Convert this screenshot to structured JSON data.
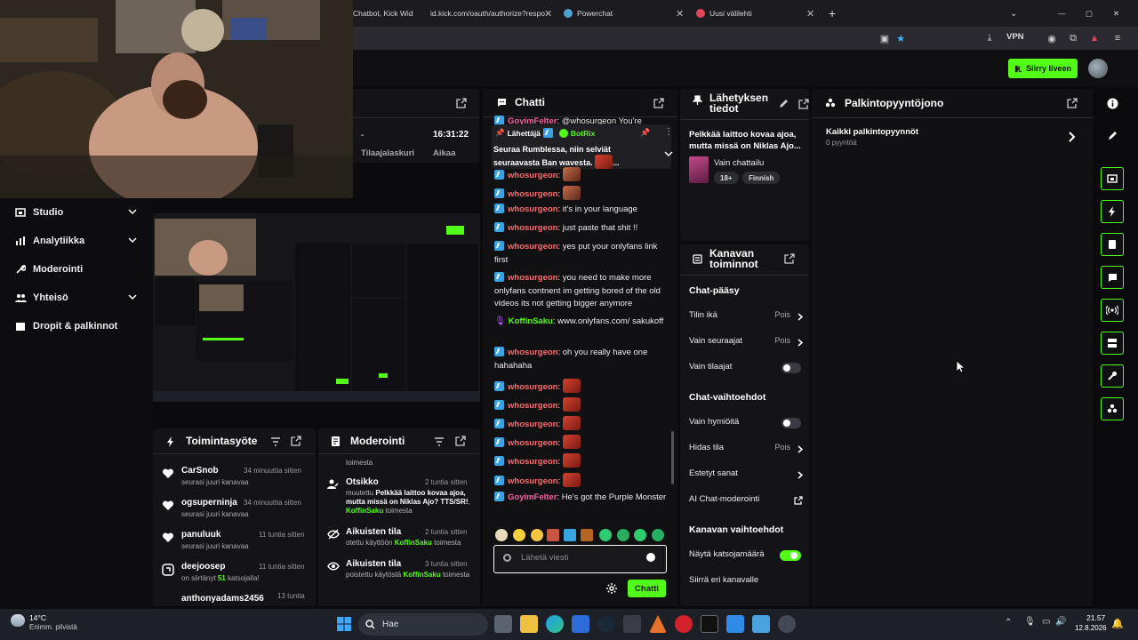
{
  "browser": {
    "tabs": [
      {
        "title": "Chatbot, Kick Wid"
      },
      {
        "title": "id.kick.com/oauth/authorize?respo"
      },
      {
        "title": "Powerchat"
      },
      {
        "title": "Uusi välilehti"
      }
    ],
    "vpn_label": "VPN",
    "new_tab": "+",
    "window_controls": [
      "—",
      "▢",
      "✕"
    ]
  },
  "header": {
    "go_live_label": "Siirry liveen"
  },
  "sidebar": {
    "items": [
      {
        "label": "Studio",
        "icon": "studio-icon",
        "expandable": true
      },
      {
        "label": "Analytiikka",
        "icon": "analytics-icon",
        "expandable": true
      },
      {
        "label": "Moderointi",
        "icon": "wrench-icon",
        "expandable": false
      },
      {
        "label": "Yhteisö",
        "icon": "community-icon",
        "expandable": true
      },
      {
        "label": "Dropit & palkinnot",
        "icon": "drops-icon",
        "expandable": false
      }
    ]
  },
  "stats": {
    "left_value": "-",
    "left_label": "Tilaajalaskuri",
    "right_value": "16:31:22",
    "right_label": "Aikaa"
  },
  "activity": {
    "title": "Toimintasyöte",
    "items": [
      {
        "name": "CarSnob",
        "desc": "seurasi juuri kanavaa",
        "time": "34 minuuttia sitten",
        "icon": "heart-icon"
      },
      {
        "name": "ogsuperninja",
        "desc": "seurasi juuri kanavaa",
        "time": "34 minuuttia sitten",
        "icon": "heart-icon"
      },
      {
        "name": "panuluuk",
        "desc": "seurasi juuri kanavaa",
        "time": "11 tuntia sitten",
        "icon": "heart-icon"
      },
      {
        "name": "deejoosep",
        "desc_prefix": "on siirtänyt ",
        "desc_count": "51",
        "desc_suffix": " katsojalla!",
        "time": "11 tuntia sitten",
        "icon": "host-icon"
      },
      {
        "name": "anthonyadams2456",
        "time": "13 tuntia"
      }
    ]
  },
  "moderation": {
    "title": "Moderointi",
    "top_text": "toimesta",
    "items": [
      {
        "title": "Otsikko",
        "time": "2 tuntia sitten",
        "d1": "muutettu ",
        "d_bold": "Pelkkää laittoo kovaa ajoa, mutta missä on Niklas Ajo? TTS/SR!",
        "d2": ", ",
        "user": "KoffinSaku",
        "d3": " toimesta"
      },
      {
        "title": "Aikuisten tila",
        "time": "2 tuntia sitten",
        "d1": "otettu käyttöön ",
        "user": "KoffinSaku",
        "d3": " toimesta"
      },
      {
        "title": "Aikuisten tila",
        "time": "3 tuntia sitten",
        "d1": "poistettu käytöstä ",
        "user": "KoffinSaku",
        "d3": " toimesta"
      }
    ]
  },
  "chat": {
    "title": "Chatti",
    "top_cut": {
      "user": "GoyimFelter",
      "text": "@whosurgeon You're"
    },
    "pinned": {
      "label": "Lähettäjä",
      "sender": "BotRix",
      "text": "Seuraa Rumblessa, niin selviät seuraavasta Ban wavesta.",
      "ellipsis": "..."
    },
    "messages": [
      {
        "user": "whosurgeon",
        "text": "",
        "emotes": 1
      },
      {
        "user": "whosurgeon",
        "text": "",
        "emotes": 1
      },
      {
        "user": "whosurgeon",
        "text": "it's in your language"
      },
      {
        "user": "whosurgeon",
        "text": "just paste that shit !!"
      },
      {
        "user": "whosurgeon",
        "text": "yes put your onlyfans link first"
      },
      {
        "user": "whosurgeon",
        "text": "you need to make more onlyfans contnent im getting bored of the old videos its not getting bigger anymore"
      },
      {
        "user": "KoffinSaku",
        "text": "www.onlyfans.com/ sakukoff",
        "mod": true
      },
      {
        "user": "whosurgeon",
        "text": "oh you really have one hahahaha"
      },
      {
        "user": "whosurgeon",
        "text": "",
        "emotes": 1
      },
      {
        "user": "whosurgeon",
        "text": "",
        "emotes": 1
      },
      {
        "user": "whosurgeon",
        "text": "",
        "emotes": 1
      },
      {
        "user": "whosurgeon",
        "text": "",
        "emotes": 1
      },
      {
        "user": "whosurgeon",
        "text": "",
        "emotes": 1
      },
      {
        "user": "whosurgeon",
        "text": "",
        "emotes": 1
      },
      {
        "user": "GoyimFelter",
        "text": "He's got the Purple Monster"
      }
    ],
    "input_placeholder": "Lähetä viesti",
    "send_label": "Chatti"
  },
  "stream_info": {
    "title": "Lähetyksen tiedot",
    "stream_title": "Pelkkää laittoo kovaa ajoa, mutta missä on Niklas Ajo...",
    "category": "Vain chattailu",
    "tags": [
      "18+",
      "Finnish"
    ]
  },
  "channel_actions": {
    "title": "Kanavan toiminnot",
    "sections": [
      {
        "heading": "Chat-pääsy",
        "rows": [
          {
            "label": "Tilin ikä",
            "value": "Pois",
            "type": "arrow"
          },
          {
            "label": "Vain seuraajat",
            "value": "Pois",
            "type": "arrow"
          },
          {
            "label": "Vain tilaajat",
            "type": "toggle",
            "on": false
          }
        ]
      },
      {
        "heading": "Chat-vaihtoehdot",
        "rows": [
          {
            "label": "Vain hymiöitä",
            "type": "toggle",
            "on": false
          },
          {
            "label": "Hidas tila",
            "value": "Pois",
            "type": "arrow"
          },
          {
            "label": "Estetyt sanat",
            "type": "arrow"
          },
          {
            "label": "AI Chat-moderointi",
            "type": "external"
          }
        ]
      },
      {
        "heading": "Kanavan vaihtoehdot",
        "rows": [
          {
            "label": "Näytä katsojamäärä",
            "type": "toggle",
            "on": true
          },
          {
            "label": "Siirrä eri kanavalle",
            "type": "none"
          }
        ]
      }
    ]
  },
  "rewards": {
    "title": "Palkintopyyntöjono",
    "all_label": "Kaikki palkintopyynnöt",
    "count_label": "0 pyyntöä"
  },
  "taskbar": {
    "weather_temp": "14°C",
    "weather_desc": "Enimm. pilvistä",
    "search_label": "Hae",
    "time": "21.57",
    "date": "12.8.2026"
  },
  "colors": {
    "accent": "#53fc18",
    "panel": "#141418",
    "background": "#0b0b0d"
  }
}
